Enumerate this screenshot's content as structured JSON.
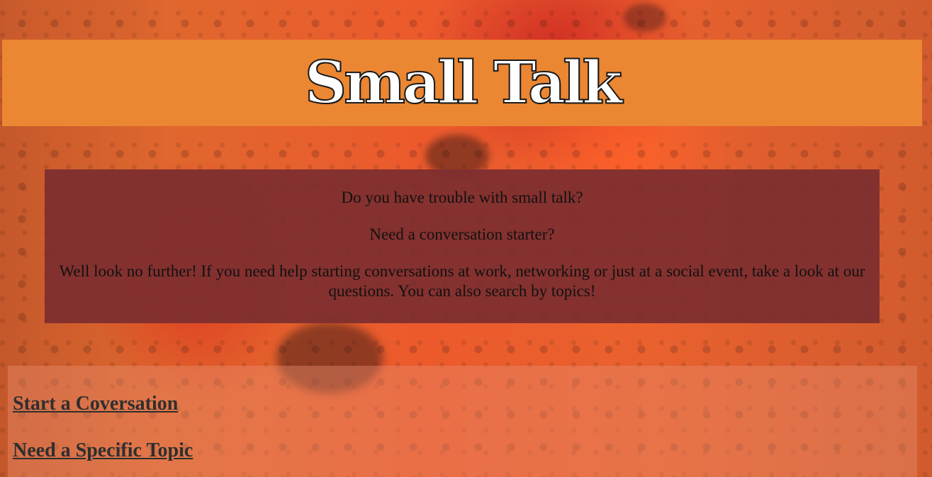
{
  "header": {
    "title": "Small Talk"
  },
  "intro": {
    "paragraphs": [
      "Do you have trouble with small talk?",
      "Need a conversation starter?",
      "Well look no further! If you need help starting conversations at work, networking or just at a social event, take a look at our questions. You can also search by topics!"
    ]
  },
  "nav": {
    "links": [
      "Start a Coversation",
      "Need a Specific Topic"
    ]
  },
  "colors": {
    "header_bg": "#eb8632",
    "intro_bg": "#803030",
    "link_text": "#2f2f2f",
    "page_bg": "#e9612e"
  }
}
